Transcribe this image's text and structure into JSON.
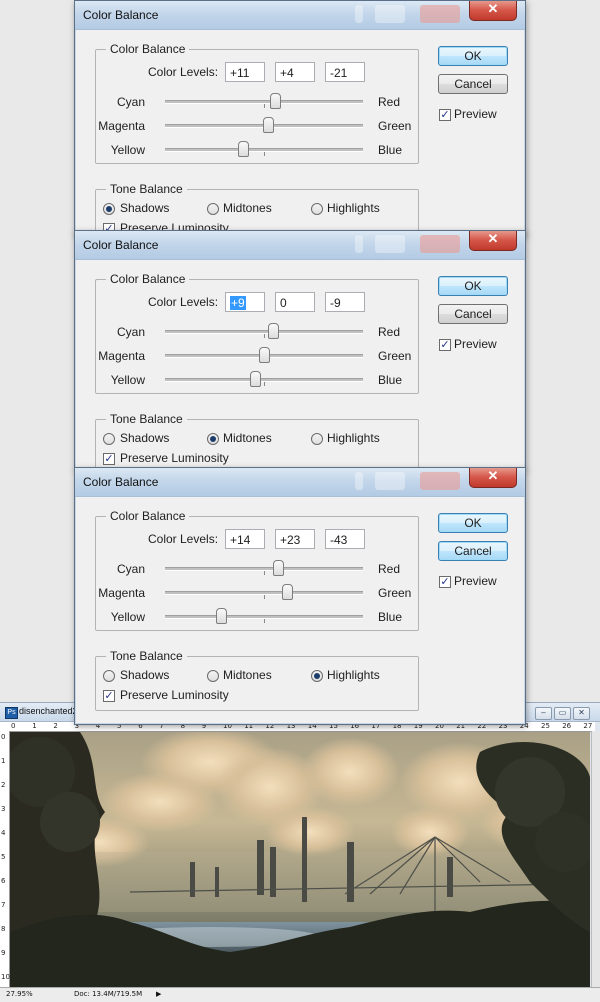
{
  "dialogs": [
    {
      "title": "Color Balance",
      "group_color": "Color Balance",
      "color_levels_label": "Color Levels:",
      "levels": [
        "+11",
        "+4",
        "-21"
      ],
      "selected_level": -1,
      "sliders": [
        {
          "left": "Cyan",
          "right": "Red",
          "value": 11
        },
        {
          "left": "Magenta",
          "right": "Green",
          "value": 4
        },
        {
          "left": "Yellow",
          "right": "Blue",
          "value": -21
        }
      ],
      "group_tone": "Tone Balance",
      "tones": [
        "Shadows",
        "Midtones",
        "Highlights"
      ],
      "selected_tone": 0,
      "preserve_luminosity": "Preserve Luminosity",
      "preserve_checked": true,
      "ok": "OK",
      "cancel": "Cancel",
      "preview": "Preview",
      "preview_checked": true,
      "default_button": "ok"
    },
    {
      "title": "Color Balance",
      "group_color": "Color Balance",
      "color_levels_label": "Color Levels:",
      "levels": [
        "+9",
        "0",
        "-9"
      ],
      "selected_level": 0,
      "sliders": [
        {
          "left": "Cyan",
          "right": "Red",
          "value": 9
        },
        {
          "left": "Magenta",
          "right": "Green",
          "value": 0
        },
        {
          "left": "Yellow",
          "right": "Blue",
          "value": -9
        }
      ],
      "group_tone": "Tone Balance",
      "tones": [
        "Shadows",
        "Midtones",
        "Highlights"
      ],
      "selected_tone": 1,
      "preserve_luminosity": "Preserve Luminosity",
      "preserve_checked": true,
      "ok": "OK",
      "cancel": "Cancel",
      "preview": "Preview",
      "preview_checked": true,
      "default_button": "ok"
    },
    {
      "title": "Color Balance",
      "group_color": "Color Balance",
      "color_levels_label": "Color Levels:",
      "levels": [
        "+14",
        "+23",
        "-43"
      ],
      "selected_level": -1,
      "sliders": [
        {
          "left": "Cyan",
          "right": "Red",
          "value": 14
        },
        {
          "left": "Magenta",
          "right": "Green",
          "value": 23
        },
        {
          "left": "Yellow",
          "right": "Blue",
          "value": -43
        }
      ],
      "group_tone": "Tone Balance",
      "tones": [
        "Shadows",
        "Midtones",
        "Highlights"
      ],
      "selected_tone": 2,
      "preserve_luminosity": "Preserve Luminosity",
      "preserve_checked": true,
      "ok": "OK",
      "cancel": "Cancel",
      "preview": "Preview",
      "preview_checked": true,
      "default_button": "cancel"
    }
  ],
  "slider_range": [
    -100,
    100
  ],
  "image_window": {
    "title": "disenchanted2",
    "ruler_top": [
      "0",
      "1",
      "2",
      "3",
      "4",
      "5",
      "6",
      "7",
      "8",
      "9",
      "10",
      "11",
      "12",
      "13",
      "14",
      "15",
      "16",
      "17",
      "18",
      "19",
      "20",
      "21",
      "22",
      "23",
      "24",
      "25",
      "26",
      "27"
    ],
    "ruler_left": [
      "0",
      "1",
      "2",
      "3",
      "4",
      "5",
      "6",
      "7",
      "8",
      "9",
      "10"
    ],
    "zoom": "27.95%",
    "doc_info": "Doc: 13.4M/719.5M"
  },
  "colors": {
    "selection": "#3399ff",
    "title_gradient_top": "#dce8f4",
    "close_red": "#c0392b"
  }
}
